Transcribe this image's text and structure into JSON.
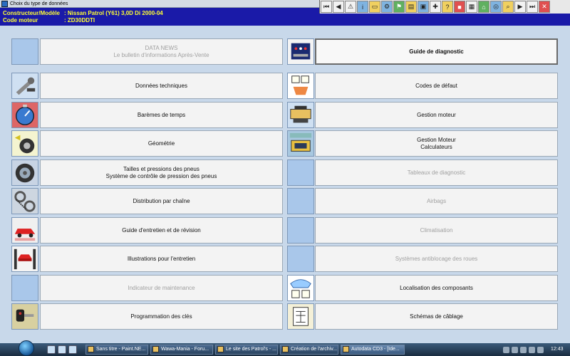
{
  "window": {
    "title": "Choix du type de données"
  },
  "header": {
    "constructeur_label": "Constructeur/Modèle",
    "constructeur_value": ": Nissan   Patrol (Y61) 3,0D Di 2000-04",
    "code_label": "Code moteur",
    "code_value": ": ZD30DDTI"
  },
  "toolbar": {
    "icons": [
      "first-icon",
      "prev-icon",
      "warning-icon",
      "info-icon",
      "vehicle-icon",
      "tools-icon",
      "flag-icon",
      "chart-icon",
      "car-icon",
      "settings-icon",
      "help-icon",
      "stop-icon",
      "print-icon",
      "home-icon",
      "wheel-icon",
      "search-icon",
      "next-icon",
      "last-icon",
      "exit-icon"
    ]
  },
  "left": [
    {
      "line1": "DATA NEWS",
      "line2": "Le bulletin d'informations Après-Vente",
      "enabled": false,
      "icon": "blank-icon"
    },
    {
      "line1": "Données techniques",
      "line2": "",
      "enabled": true,
      "icon": "wrench-icon"
    },
    {
      "line1": "Barèmes de temps",
      "line2": "",
      "enabled": true,
      "icon": "stopwatch-icon"
    },
    {
      "line1": "Géométrie",
      "line2": "",
      "enabled": true,
      "icon": "wheel-alignment-icon"
    },
    {
      "line1": "Tailles et pressions des pneus",
      "line2": "Système de contrôle de pression des pneus",
      "enabled": true,
      "icon": "tyre-icon"
    },
    {
      "line1": "Distribution par chaîne",
      "line2": "",
      "enabled": true,
      "icon": "timing-chain-icon"
    },
    {
      "line1": "Guide d'entretien et de révision",
      "line2": "",
      "enabled": true,
      "icon": "service-car-icon"
    },
    {
      "line1": "Illustrations pour l'entretien",
      "line2": "",
      "enabled": true,
      "icon": "car-lift-icon"
    },
    {
      "line1": "Indicateur de maintenance",
      "line2": "",
      "enabled": false,
      "icon": "blank-icon"
    },
    {
      "line1": "Programmation des clés",
      "line2": "",
      "enabled": true,
      "icon": "car-key-icon"
    }
  ],
  "right": [
    {
      "line1": "Guide de diagnostic",
      "line2": "",
      "enabled": true,
      "selected": true,
      "icon": "diagnostic-device-icon"
    },
    {
      "line1": "Codes de défaut",
      "line2": "",
      "enabled": true,
      "selected": false,
      "icon": "fault-codes-icon"
    },
    {
      "line1": "Gestion moteur",
      "line2": "",
      "enabled": true,
      "selected": false,
      "icon": "engine-management-icon"
    },
    {
      "line1": "Gestion Moteur",
      "line2": "Calculateurs",
      "enabled": true,
      "selected": false,
      "icon": "ecu-icon"
    },
    {
      "line1": "Tableaux de diagnostic",
      "line2": "",
      "enabled": false,
      "selected": false,
      "icon": "blank-icon"
    },
    {
      "line1": "Airbags",
      "line2": "",
      "enabled": false,
      "selected": false,
      "icon": "blank-icon"
    },
    {
      "line1": "Climatisation",
      "line2": "",
      "enabled": false,
      "selected": false,
      "icon": "blank-icon"
    },
    {
      "line1": "Systèmes antiblocage des roues",
      "line2": "",
      "enabled": false,
      "selected": false,
      "icon": "blank-icon"
    },
    {
      "line1": "Localisation des composants",
      "line2": "",
      "enabled": true,
      "selected": false,
      "icon": "component-location-icon"
    },
    {
      "line1": "Schémas de câblage",
      "line2": "",
      "enabled": true,
      "selected": false,
      "icon": "wiring-diagram-icon"
    }
  ],
  "taskbar": {
    "tasks": [
      {
        "label": "Sans titre - Paint.NE...",
        "active": false
      },
      {
        "label": "Wawa-Mania - Foru...",
        "active": false
      },
      {
        "label": "Le site des Patrol's - ...",
        "active": false
      },
      {
        "label": "Création de l'archiv...",
        "active": false
      },
      {
        "label": "Autodata CD3 - [Ide...",
        "active": true
      }
    ],
    "clock": "12:43"
  }
}
